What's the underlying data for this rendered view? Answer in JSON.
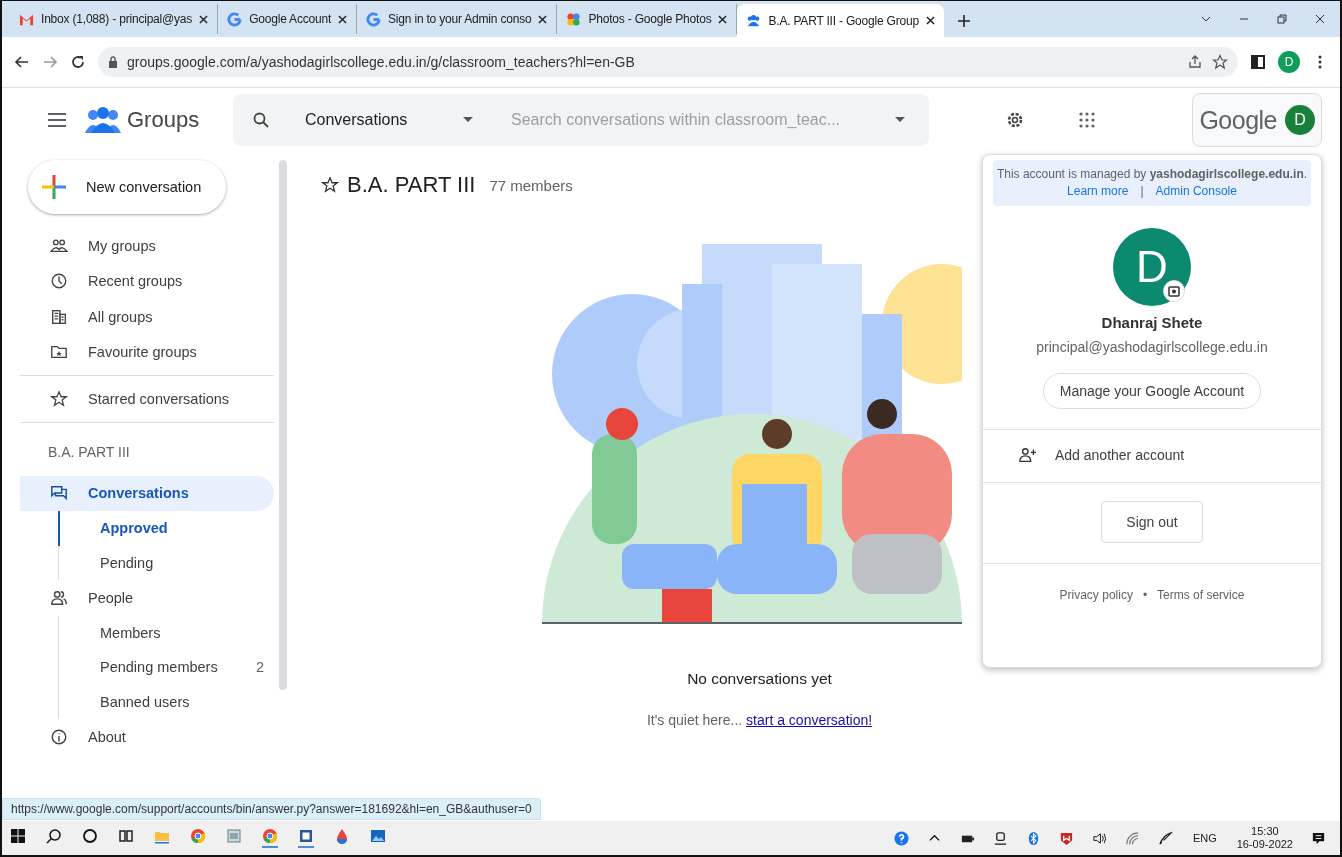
{
  "browser": {
    "tabs": [
      {
        "title": "Inbox (1,088) - principal@yas",
        "kind": "mail",
        "selected": false
      },
      {
        "title": "Google Account",
        "kind": "g",
        "selected": false
      },
      {
        "title": "Sign in to your Admin conso",
        "kind": "g",
        "selected": false
      },
      {
        "title": "Photos - Google Photos",
        "kind": "photos",
        "selected": false
      },
      {
        "title": "B.A. PART III - Google Group",
        "kind": "people",
        "selected": true
      }
    ],
    "url": "groups.google.com/a/yashodagirlscollege.edu.in/g/classroom_teachers?hl=en-GB",
    "profile_initial": "D"
  },
  "header": {
    "title": "Groups",
    "search_scope": "Conversations",
    "search_placeholder": "Search conversations within classroom_teac...",
    "brand": "Google",
    "avatar_initial": "D"
  },
  "sidebar": {
    "new_button": "New conversation",
    "nav": [
      {
        "label": "My groups",
        "selected": false
      },
      {
        "label": "Recent groups",
        "selected": false
      },
      {
        "label": "All groups",
        "selected": false
      },
      {
        "label": "Favourite groups",
        "selected": false
      }
    ],
    "starred": {
      "label": "Starred conversations",
      "selected": false
    },
    "group_name": "B.A. PART III",
    "group_nav": [
      {
        "label": "Conversations",
        "selected": true,
        "children": [
          {
            "label": "Approved",
            "selected": true
          },
          {
            "label": "Pending",
            "selected": false
          }
        ]
      },
      {
        "label": "People",
        "selected": false,
        "children": [
          {
            "label": "Members",
            "selected": false
          },
          {
            "label": "Pending members",
            "count": "2",
            "selected": false
          },
          {
            "label": "Banned users",
            "selected": false
          }
        ]
      },
      {
        "label": "About",
        "selected": false
      }
    ]
  },
  "main": {
    "group_title": "B.A. PART III",
    "members": "77 members",
    "empty_title": "No conversations yet",
    "empty_text": "It's quiet here...",
    "empty_link": "start a conversation!"
  },
  "account_menu": {
    "managed_text": "This account is managed by **yashodagirlscollege.edu.in**.",
    "learn_more": "Learn more",
    "separator": "|",
    "admin_console": "Admin Console",
    "avatar_initial": "D",
    "name": "Dhanraj Shete",
    "email": "principal@yashodagirlscollege.edu.in",
    "manage_button": "Manage your Google Account",
    "add_account": "Add another account",
    "sign_out": "Sign out",
    "privacy": "Privacy policy",
    "dot": "•",
    "terms": "Terms of service"
  },
  "status_url": "https://www.google.com/support/accounts/bin/answer.py?answer=181692&hl=en_GB&authuser=0",
  "taskbar": {
    "language": "ENG",
    "time": "15:30",
    "date": "16-09-2022"
  }
}
